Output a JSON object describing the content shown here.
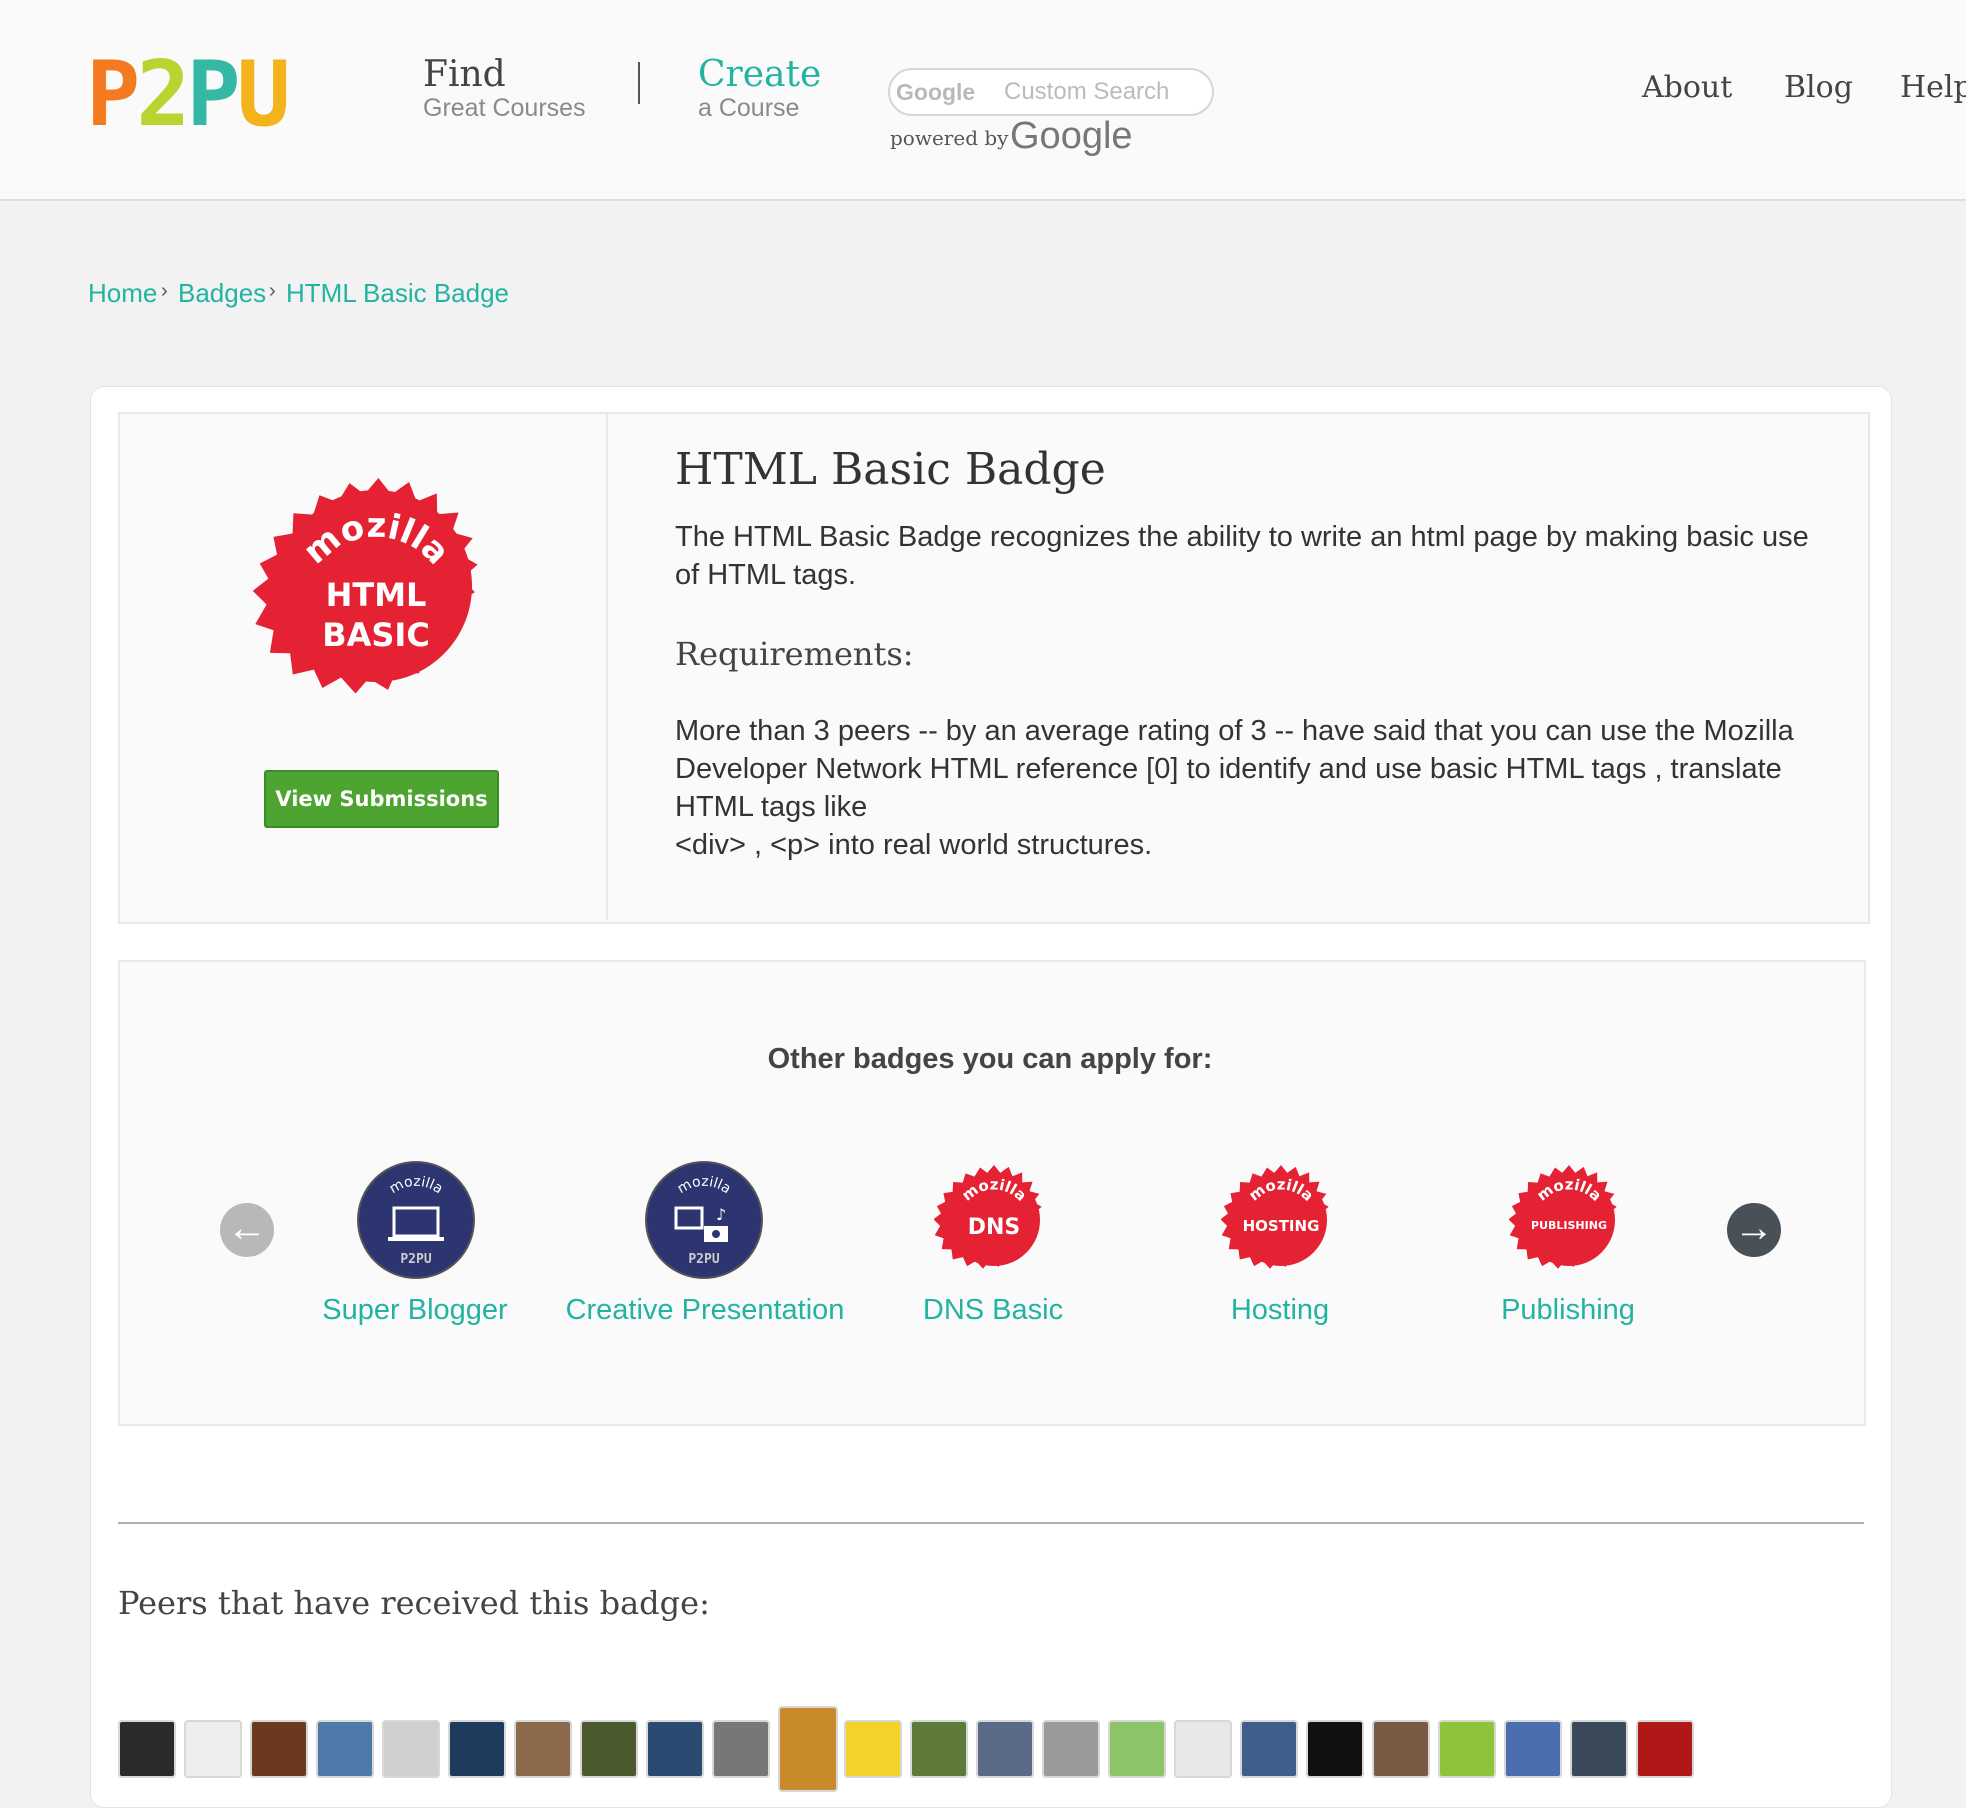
{
  "header": {
    "logo": [
      "P",
      "2",
      "P",
      "U"
    ],
    "find": {
      "main": "Find",
      "sub": "Great Courses"
    },
    "create": {
      "main": "Create",
      "sub": "a Course"
    },
    "search": {
      "brand": "Google",
      "placeholder": "Custom Search",
      "powered_by": "powered by",
      "powered_brand": "Google"
    },
    "links": [
      "About",
      "Blog",
      "Help"
    ]
  },
  "breadcrumb": [
    "Home",
    "Badges",
    "HTML Basic Badge"
  ],
  "badge": {
    "icon_text": {
      "brand": "mozilla",
      "line1": "HTML",
      "line2": "BASIC"
    },
    "view_button": "View Submissions",
    "title": "HTML Basic Badge",
    "description": "The HTML Basic Badge recognizes the ability to write an html page by making basic use of HTML tags.",
    "requirements_heading": "Requirements:",
    "requirements_text": "More than 3 peers -- by an average rating of 3 -- have said that you can use the Mozilla Developer Network HTML reference [0] to identify and use basic HTML tags , translate HTML tags like",
    "requirements_text2": "<div> , <p> into real world structures."
  },
  "other_badges": {
    "heading": "Other badges you can apply for:",
    "items": [
      {
        "label": "Super Blogger",
        "icon": "laptop-badge-icon",
        "brand": "mozilla",
        "mark": "P2PU"
      },
      {
        "label": "Creative Presentation",
        "icon": "media-badge-icon",
        "brand": "mozilla",
        "mark": "P2PU"
      },
      {
        "label": "DNS Basic",
        "icon": "dns-badge-icon",
        "brand": "mozilla",
        "mark": "DNS"
      },
      {
        "label": "Hosting",
        "icon": "hosting-badge-icon",
        "brand": "mozilla",
        "mark": "HOSTING"
      },
      {
        "label": "Publishing",
        "icon": "publishing-badge-icon",
        "brand": "mozilla",
        "mark": "PUBLISHING"
      }
    ]
  },
  "peers": {
    "heading": "Peers that have received this badge:",
    "avatar_colors": [
      "#2a2a2a",
      "#eeeeee",
      "#6b3a1e",
      "#4d7aa8",
      "#cfcfcf",
      "#1d3b5c",
      "#8a6a4a",
      "#4b5a2e",
      "#2b4a72",
      "#777777",
      "#c98a2a",
      "#f3d22a",
      "#5d7a3a",
      "#5a6a88",
      "#9a9a9a",
      "#8cc46a",
      "#e8e8e8",
      "#3f5f8a",
      "#111111",
      "#7a5a44",
      "#8fc43a",
      "#4a6eb0",
      "#3b4a5a",
      "#b01818"
    ]
  }
}
